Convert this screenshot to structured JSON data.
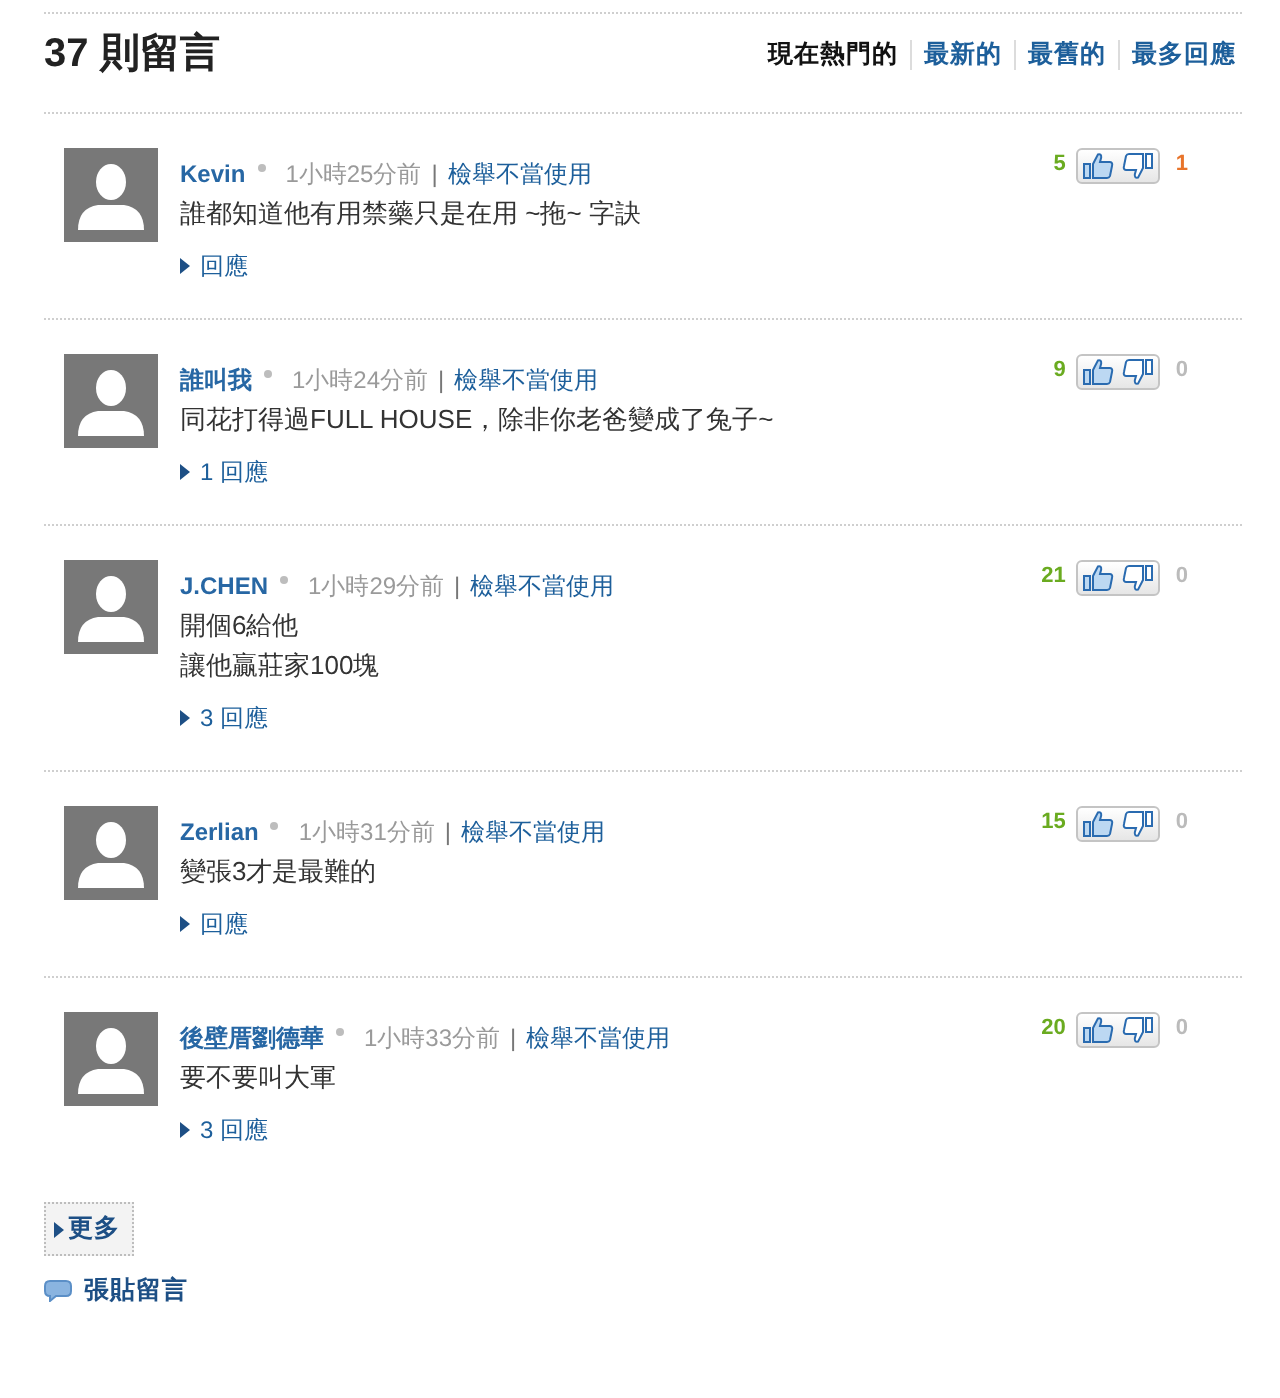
{
  "header": {
    "title": "37 則留言",
    "sort_tabs": [
      {
        "label": "現在熱門的",
        "selected": true
      },
      {
        "label": "最新的",
        "selected": false
      },
      {
        "label": "最舊的",
        "selected": false
      },
      {
        "label": "最多回應",
        "selected": false
      }
    ]
  },
  "comments": [
    {
      "author": "Kevin",
      "time": "1小時25分前",
      "separator": "|",
      "report_link": "檢舉不當使用",
      "text_lines": [
        "誰都知道他有用禁藥只是在用 ~拖~ 字訣"
      ],
      "likes": "5",
      "dislikes": {
        "count": "1",
        "color": "#e8742a"
      },
      "replies": "回應"
    },
    {
      "author": "誰叫我",
      "time": "1小時24分前",
      "separator": "|",
      "report_link": "檢舉不當使用",
      "text_lines": [
        "同花打得過FULL HOUSE，除非你老爸變成了兔子~"
      ],
      "likes": "9",
      "dislikes": {
        "count": "0",
        "color": "#bbbbbb"
      },
      "replies": "1 回應"
    },
    {
      "author": "J.CHEN",
      "time": "1小時29分前",
      "separator": "|",
      "report_link": "檢舉不當使用",
      "text_lines": [
        "開個6給他",
        "讓他贏莊家100塊"
      ],
      "likes": "21",
      "dislikes": {
        "count": "0",
        "color": "#bbbbbb"
      },
      "replies": "3 回應"
    },
    {
      "author": "Zerlian",
      "time": "1小時31分前",
      "separator": "|",
      "report_link": "檢舉不當使用",
      "text_lines": [
        "變張3才是最難的"
      ],
      "likes": "15",
      "dislikes": {
        "count": "0",
        "color": "#bbbbbb"
      },
      "replies": "回應"
    },
    {
      "author": "後壁厝劉德華",
      "time": "1小時33分前",
      "separator": "|",
      "report_link": "檢舉不當使用",
      "text_lines": [
        "要不要叫大軍"
      ],
      "likes": "20",
      "dislikes": {
        "count": "0",
        "color": "#bbbbbb"
      },
      "replies": "3 回應"
    }
  ],
  "more_button": "更多",
  "post_link": "張貼留言"
}
